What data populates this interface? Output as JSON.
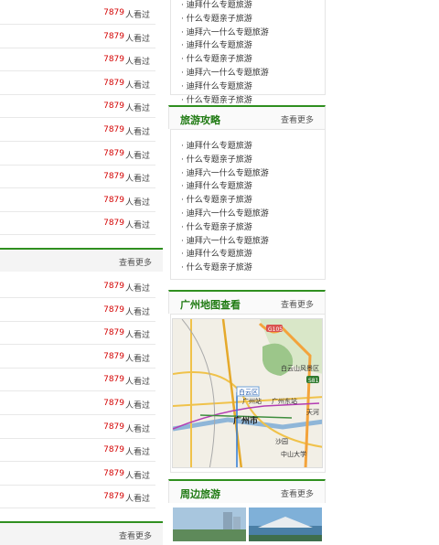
{
  "left_rows_1": [
    {
      "count": "7879",
      "label": "人看过"
    },
    {
      "count": "7879",
      "label": "人看过"
    },
    {
      "count": "7879",
      "label": "人看过"
    },
    {
      "count": "7879",
      "label": "人看过"
    },
    {
      "count": "7879",
      "label": "人看过"
    },
    {
      "count": "7879",
      "label": "人看过"
    },
    {
      "count": "7879",
      "label": "人看过"
    },
    {
      "count": "7879",
      "label": "人看过"
    },
    {
      "count": "7879",
      "label": "人看过"
    },
    {
      "count": "7879",
      "label": "人看过"
    }
  ],
  "left_bar_1": {
    "more": "查看更多"
  },
  "left_rows_2": [
    {
      "count": "7879",
      "label": "人看过"
    },
    {
      "count": "7879",
      "label": "人看过"
    },
    {
      "count": "7879",
      "label": "人看过"
    },
    {
      "count": "7879",
      "label": "人看过"
    },
    {
      "count": "7879",
      "label": "人看过"
    },
    {
      "count": "7879",
      "label": "人看过"
    },
    {
      "count": "7879",
      "label": "人看过"
    },
    {
      "count": "7879",
      "label": "人看过"
    },
    {
      "count": "7879",
      "label": "人看过"
    },
    {
      "count": "7879",
      "label": "人看过"
    }
  ],
  "left_bar_2": {
    "more": "查看更多"
  },
  "top_list": [
    "迪拜什么专题旅游",
    "什么专题亲子旅游",
    "迪拜六一什么专题旅游",
    "迪拜什么专题旅游",
    "什么专题亲子旅游",
    "迪拜六一什么专题旅游",
    "迪拜什么专题旅游",
    "什么专题亲子旅游"
  ],
  "guide": {
    "title": "旅游攻略",
    "more": "查看更多",
    "items": [
      "迪拜什么专题旅游",
      "什么专题亲子旅游",
      "迪拜六一什么专题旅游",
      "迪拜什么专题旅游",
      "什么专题亲子旅游",
      "迪拜六一什么专题旅游",
      "什么专题亲子旅游",
      "迪拜六一什么专题旅游",
      "迪拜什么专题旅游",
      "什么专题亲子旅游"
    ]
  },
  "map_section": {
    "title": "广州地图查看",
    "more": "查看更多",
    "labels": {
      "baiyun_district": "白云区",
      "guangzhou_city": "广州市",
      "guangzhou_station": "广州站",
      "guangzhou_east": "广州东站",
      "scenic": "白云山风景区",
      "tianhe": "天河",
      "sysu": "中山大学",
      "shapo": "沙园",
      "g105": "G105",
      "s81": "S81"
    }
  },
  "nearby": {
    "title": "周边旅游",
    "more": "查看更多"
  },
  "colors": {
    "accent_green": "#2f8f1f",
    "count_red": "#d40000"
  }
}
